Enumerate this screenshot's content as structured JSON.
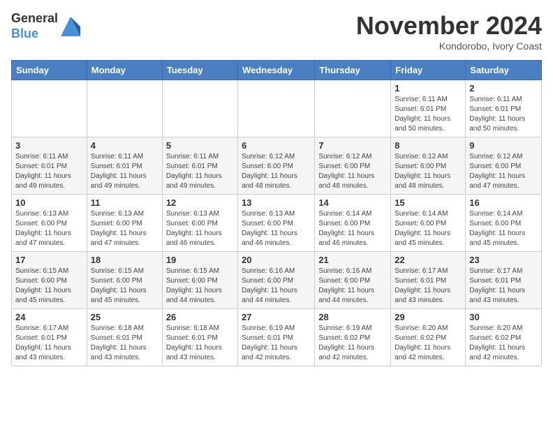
{
  "logo": {
    "general": "General",
    "blue": "Blue"
  },
  "title": "November 2024",
  "location": "Kondorobo, Ivory Coast",
  "days_of_week": [
    "Sunday",
    "Monday",
    "Tuesday",
    "Wednesday",
    "Thursday",
    "Friday",
    "Saturday"
  ],
  "weeks": [
    [
      {
        "day": "",
        "info": ""
      },
      {
        "day": "",
        "info": ""
      },
      {
        "day": "",
        "info": ""
      },
      {
        "day": "",
        "info": ""
      },
      {
        "day": "",
        "info": ""
      },
      {
        "day": "1",
        "info": "Sunrise: 6:11 AM\nSunset: 6:01 PM\nDaylight: 11 hours\nand 50 minutes."
      },
      {
        "day": "2",
        "info": "Sunrise: 6:11 AM\nSunset: 6:01 PM\nDaylight: 11 hours\nand 50 minutes."
      }
    ],
    [
      {
        "day": "3",
        "info": "Sunrise: 6:11 AM\nSunset: 6:01 PM\nDaylight: 11 hours\nand 49 minutes."
      },
      {
        "day": "4",
        "info": "Sunrise: 6:11 AM\nSunset: 6:01 PM\nDaylight: 11 hours\nand 49 minutes."
      },
      {
        "day": "5",
        "info": "Sunrise: 6:11 AM\nSunset: 6:01 PM\nDaylight: 11 hours\nand 49 minutes."
      },
      {
        "day": "6",
        "info": "Sunrise: 6:12 AM\nSunset: 6:00 PM\nDaylight: 11 hours\nand 48 minutes."
      },
      {
        "day": "7",
        "info": "Sunrise: 6:12 AM\nSunset: 6:00 PM\nDaylight: 11 hours\nand 48 minutes."
      },
      {
        "day": "8",
        "info": "Sunrise: 6:12 AM\nSunset: 6:00 PM\nDaylight: 11 hours\nand 48 minutes."
      },
      {
        "day": "9",
        "info": "Sunrise: 6:12 AM\nSunset: 6:00 PM\nDaylight: 11 hours\nand 47 minutes."
      }
    ],
    [
      {
        "day": "10",
        "info": "Sunrise: 6:13 AM\nSunset: 6:00 PM\nDaylight: 11 hours\nand 47 minutes."
      },
      {
        "day": "11",
        "info": "Sunrise: 6:13 AM\nSunset: 6:00 PM\nDaylight: 11 hours\nand 47 minutes."
      },
      {
        "day": "12",
        "info": "Sunrise: 6:13 AM\nSunset: 6:00 PM\nDaylight: 11 hours\nand 46 minutes."
      },
      {
        "day": "13",
        "info": "Sunrise: 6:13 AM\nSunset: 6:00 PM\nDaylight: 11 hours\nand 46 minutes."
      },
      {
        "day": "14",
        "info": "Sunrise: 6:14 AM\nSunset: 6:00 PM\nDaylight: 11 hours\nand 46 minutes."
      },
      {
        "day": "15",
        "info": "Sunrise: 6:14 AM\nSunset: 6:00 PM\nDaylight: 11 hours\nand 45 minutes."
      },
      {
        "day": "16",
        "info": "Sunrise: 6:14 AM\nSunset: 6:00 PM\nDaylight: 11 hours\nand 45 minutes."
      }
    ],
    [
      {
        "day": "17",
        "info": "Sunrise: 6:15 AM\nSunset: 6:00 PM\nDaylight: 11 hours\nand 45 minutes."
      },
      {
        "day": "18",
        "info": "Sunrise: 6:15 AM\nSunset: 6:00 PM\nDaylight: 11 hours\nand 45 minutes."
      },
      {
        "day": "19",
        "info": "Sunrise: 6:15 AM\nSunset: 6:00 PM\nDaylight: 11 hours\nand 44 minutes."
      },
      {
        "day": "20",
        "info": "Sunrise: 6:16 AM\nSunset: 6:00 PM\nDaylight: 11 hours\nand 44 minutes."
      },
      {
        "day": "21",
        "info": "Sunrise: 6:16 AM\nSunset: 6:00 PM\nDaylight: 11 hours\nand 44 minutes."
      },
      {
        "day": "22",
        "info": "Sunrise: 6:17 AM\nSunset: 6:01 PM\nDaylight: 11 hours\nand 43 minutes."
      },
      {
        "day": "23",
        "info": "Sunrise: 6:17 AM\nSunset: 6:01 PM\nDaylight: 11 hours\nand 43 minutes."
      }
    ],
    [
      {
        "day": "24",
        "info": "Sunrise: 6:17 AM\nSunset: 6:01 PM\nDaylight: 11 hours\nand 43 minutes."
      },
      {
        "day": "25",
        "info": "Sunrise: 6:18 AM\nSunset: 6:01 PM\nDaylight: 11 hours\nand 43 minutes."
      },
      {
        "day": "26",
        "info": "Sunrise: 6:18 AM\nSunset: 6:01 PM\nDaylight: 11 hours\nand 43 minutes."
      },
      {
        "day": "27",
        "info": "Sunrise: 6:19 AM\nSunset: 6:01 PM\nDaylight: 11 hours\nand 42 minutes."
      },
      {
        "day": "28",
        "info": "Sunrise: 6:19 AM\nSunset: 6:02 PM\nDaylight: 11 hours\nand 42 minutes."
      },
      {
        "day": "29",
        "info": "Sunrise: 6:20 AM\nSunset: 6:02 PM\nDaylight: 11 hours\nand 42 minutes."
      },
      {
        "day": "30",
        "info": "Sunrise: 6:20 AM\nSunset: 6:02 PM\nDaylight: 11 hours\nand 42 minutes."
      }
    ]
  ]
}
